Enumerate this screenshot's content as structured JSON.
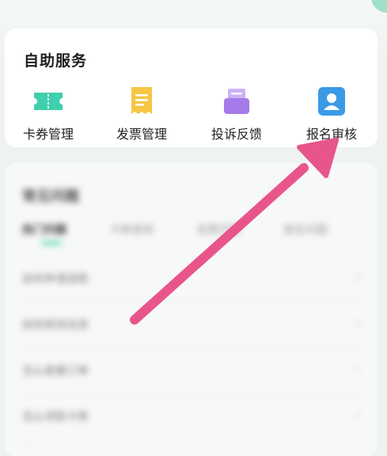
{
  "self_service": {
    "title": "自助服务",
    "items": [
      {
        "label": "卡券管理",
        "icon": "ticket-icon",
        "color": "#3fcfad"
      },
      {
        "label": "发票管理",
        "icon": "invoice-icon",
        "color": "#f7c544"
      },
      {
        "label": "投诉反馈",
        "icon": "complaint-icon",
        "color": "#a47be8"
      },
      {
        "label": "报名审核",
        "icon": "registration-review-icon",
        "color": "#3b9ae6"
      }
    ]
  },
  "help": {
    "title": "常见问题",
    "tabs": [
      "热门问题",
      "卡券使用",
      "发票问题",
      "报名问题"
    ],
    "rows": [
      {
        "text": "如何申请退款"
      },
      {
        "text": "如何修改信息"
      },
      {
        "text": "怎么查看订单"
      },
      {
        "text": "怎么领取卡券"
      }
    ]
  },
  "annotation": {
    "type": "arrow",
    "color": "#e8558b",
    "points_to": "报名审核"
  }
}
